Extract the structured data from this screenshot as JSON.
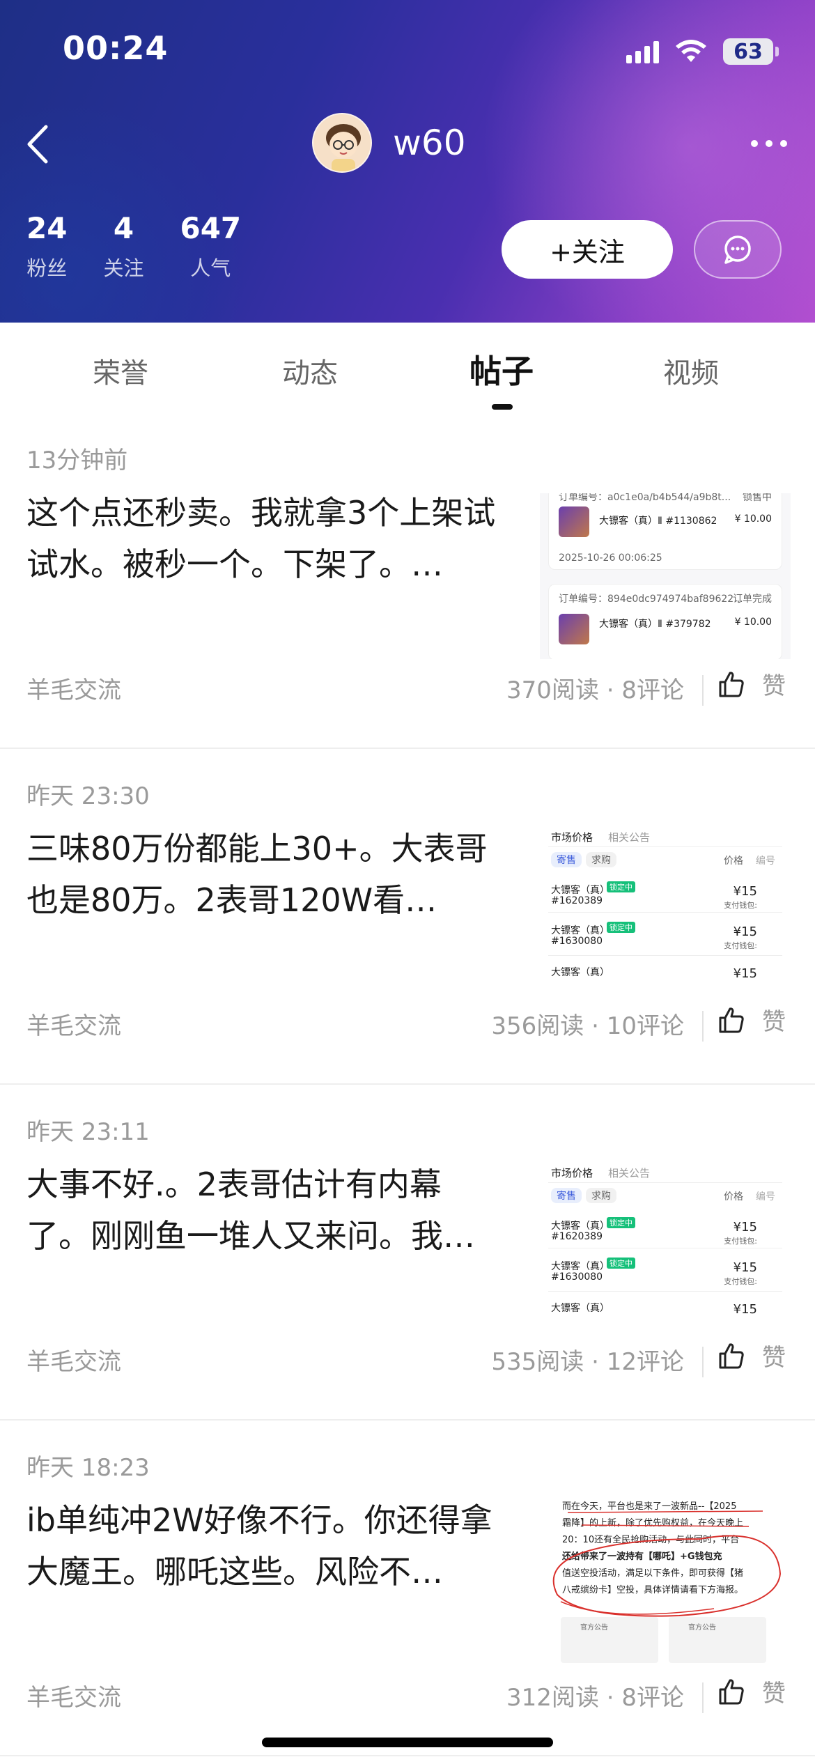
{
  "status_bar": {
    "time": "00:24",
    "battery": "63"
  },
  "profile": {
    "username": "w60",
    "follow_label": "+关注",
    "stats": [
      {
        "num": "24",
        "label": "粉丝"
      },
      {
        "num": "4",
        "label": "关注"
      },
      {
        "num": "647",
        "label": "人气"
      }
    ]
  },
  "tabs": [
    {
      "label": "荣誉"
    },
    {
      "label": "动态"
    },
    {
      "label": "帖子"
    },
    {
      "label": "视频"
    }
  ],
  "active_tab": "帖子",
  "posts": [
    {
      "time": "13分钟前",
      "text": "这个点还秒卖。我就拿3个上架试试水。被秒一个。下架了。…",
      "category": "羊毛交流",
      "meta": "370阅读 · 8评论",
      "like": "赞",
      "thumb": {
        "order1_no": "订单编号：a0c1e0a/b4b544/a9b8t...",
        "order1_status": "锁售中",
        "order1_item": "大镖客（真）Ⅱ #1130862",
        "order1_price": "¥ 10.00",
        "order1_date": "2025-10-26 00:06:25",
        "order2_no": "订单编号：894e0dc974974baf89622...",
        "order2_status": "订单完成",
        "order2_item": "大镖客（真）Ⅱ #379782",
        "order2_price": "¥ 10.00"
      }
    },
    {
      "time": "昨天 23:30",
      "text": "三味80万份都能上30+。大表哥也是80万。2表哥120W看…",
      "category": "羊毛交流",
      "meta": "356阅读 · 10评论",
      "like": "赞",
      "thumb": {
        "tab1": "市场价格",
        "tab2": "相关公告",
        "chip1": "寄售",
        "chip2": "求购",
        "col1": "价格",
        "col2": "编号",
        "rows": [
          {
            "name": "大镖客（真）",
            "badge": "锁定中",
            "id": "#1620389",
            "price": "¥15",
            "sub": "支付钱包:"
          },
          {
            "name": "大镖客（真）",
            "badge": "锁定中",
            "id": "#1630080",
            "price": "¥15",
            "sub": "支付钱包:"
          },
          {
            "name": "大镖客（真）",
            "badge": "",
            "id": "",
            "price": "¥15",
            "sub": ""
          }
        ]
      }
    },
    {
      "time": "昨天 23:11",
      "text": "大事不好.。2表哥估计有内幕了。刚刚鱼一堆人又来问。我…",
      "category": "羊毛交流",
      "meta": "535阅读 · 12评论",
      "like": "赞",
      "thumb": {
        "tab1": "市场价格",
        "tab2": "相关公告",
        "chip1": "寄售",
        "chip2": "求购",
        "col1": "价格",
        "col2": "编号",
        "rows": [
          {
            "name": "大镖客（真）",
            "badge": "锁定中",
            "id": "#1620389",
            "price": "¥15",
            "sub": "支付钱包:"
          },
          {
            "name": "大镖客（真）",
            "badge": "锁定中",
            "id": "#1630080",
            "price": "¥15",
            "sub": "支付钱包:"
          },
          {
            "name": "大镖客（真）",
            "badge": "",
            "id": "",
            "price": "¥15",
            "sub": ""
          }
        ]
      }
    },
    {
      "time": "昨天 18:23",
      "text": "ib单纯冲2W好像不行。你还得拿大魔王。哪吒这些。风险不…",
      "category": "羊毛交流",
      "meta": "312阅读 · 8评论",
      "like": "赞",
      "thumb": {
        "line1": "而在今天，平台也是来了一波新品--【2025",
        "line2": "霜降】的上新，除了优先购权益，在今天晚上",
        "line3": "20：10还有全民抢购活动，与此同时，平台",
        "line4": "还给带来了一波持有【哪吒】+G钱包充",
        "line5": "值送空投活动，满足以下条件，即可获得【猪",
        "line6": "八戒缤纷卡】空投，具体详情请看下方海报。",
        "caption1": "官方公告",
        "caption2": "官方公告"
      }
    }
  ]
}
